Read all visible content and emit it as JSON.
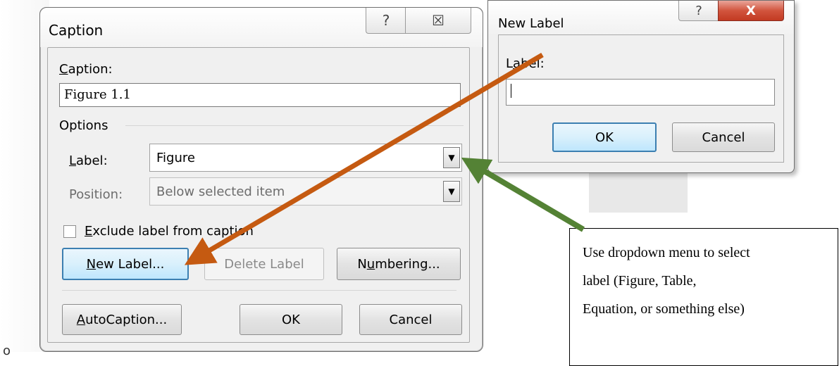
{
  "bullet": "o",
  "caption_dialog": {
    "title": "Caption",
    "help_glyph": "?",
    "close_glyph": "☒",
    "caption_label_first": "C",
    "caption_label_rest": "aption:",
    "caption_value": "Figure 1.1",
    "options_label": "Options",
    "label_field_label_first": "L",
    "label_field_label_rest": "abel:",
    "label_value": "Figure",
    "position_label": "Position:",
    "position_value": "Below selected item",
    "exclude_first": "E",
    "exclude_rest": "xclude label from caption",
    "new_label_first": "N",
    "new_label_rest": "ew Label...",
    "delete_label": "Delete Label",
    "numbering_pre": "N",
    "numbering_u": "u",
    "numbering_rest": "mbering...",
    "autocaption_first": "A",
    "autocaption_rest": "utoCaption...",
    "ok": "OK",
    "cancel": "Cancel"
  },
  "new_label_dialog": {
    "title": "New Label",
    "help_glyph": "?",
    "close_glyph": "X",
    "label_pre": "L",
    "label_u": "a",
    "label_rest": "bel:",
    "label_value": "",
    "ok": "OK",
    "cancel": "Cancel"
  },
  "callout": {
    "line1": "Use dropdown menu to select",
    "line2": "label (Figure, Table,",
    "line3": "Equation, or something else)"
  },
  "colors": {
    "orange_arrow": "#c55a11",
    "green_arrow": "#548235"
  }
}
